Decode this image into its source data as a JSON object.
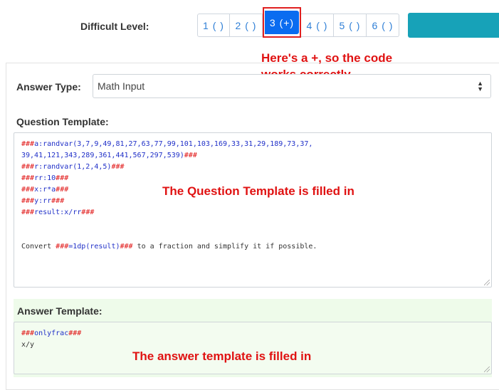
{
  "difficulty": {
    "label": "Difficult Level:",
    "levels": [
      "1 ( )",
      "2 ( )",
      "3 (+)",
      "4 ( )",
      "5 ( )",
      "6 ( )"
    ],
    "selected": "3 (+)",
    "accent_color": "#0a6cf0"
  },
  "annotations": {
    "plus_note_line1": "Here's a +, so the code",
    "plus_note_line2": "works correctly",
    "question_note": "The Question Template is filled in",
    "answer_note": "The answer template is filled in",
    "color": "#e01212"
  },
  "form": {
    "answer_type_label": "Answer Type:",
    "answer_type_value": "Math Input",
    "question_template_label": "Question Template:",
    "question_template_lines": [
      [
        [
          "red",
          "###"
        ],
        [
          "blue",
          "a:randvar(3,7,9,49,81,27,63,77,99,101,103,169,33,31,29,189,73,37,"
        ]
      ],
      [
        [
          "blue",
          "39,41,121,343,289,361,441,567,297,539)"
        ],
        [
          "red",
          "###"
        ]
      ],
      [
        [
          "red",
          "###"
        ],
        [
          "blue",
          "r:randvar(1,2,4,5)"
        ],
        [
          "red",
          "###"
        ]
      ],
      [
        [
          "red",
          "###"
        ],
        [
          "blue",
          "rr:10"
        ],
        [
          "red",
          "###"
        ]
      ],
      [
        [
          "red",
          "###"
        ],
        [
          "blue",
          "x:r*a"
        ],
        [
          "red",
          "###"
        ]
      ],
      [
        [
          "red",
          "###"
        ],
        [
          "blue",
          "y:rr"
        ],
        [
          "red",
          "###"
        ]
      ],
      [
        [
          "red",
          "###"
        ],
        [
          "blue",
          "result:x/rr"
        ],
        [
          "red",
          "###"
        ]
      ],
      [],
      [],
      [
        [
          "dark",
          "Convert "
        ],
        [
          "red",
          "###"
        ],
        [
          "blue",
          "=1dp(result)"
        ],
        [
          "red",
          "###"
        ],
        [
          "dark",
          " to a fraction and simplify it if possible."
        ]
      ]
    ],
    "answer_template_label": "Answer Template:",
    "answer_template_lines": [
      [
        [
          "red",
          "###"
        ],
        [
          "blue",
          "onlyfrac"
        ],
        [
          "red",
          "###"
        ]
      ],
      [
        [
          "dark",
          "x/y"
        ]
      ]
    ]
  }
}
